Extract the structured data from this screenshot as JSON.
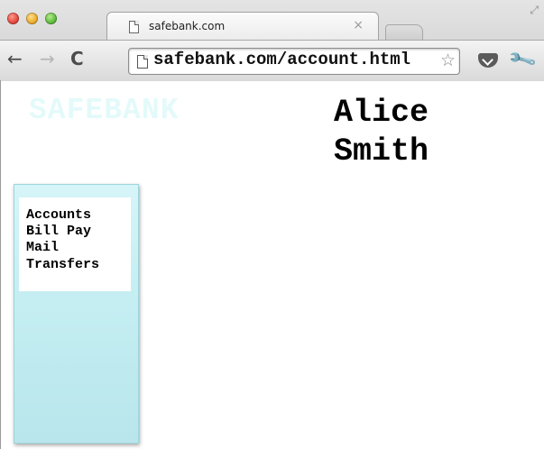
{
  "browser": {
    "tab_title": "safebank.com",
    "tab_close": "×",
    "url": "safebank.com/account.html",
    "nav": {
      "back": "←",
      "forward": "→",
      "reload": "C"
    },
    "star": "☆",
    "wrench": "🔧",
    "fullscreen": "⤢"
  },
  "page": {
    "logo": "SAFEBANK",
    "user_first": "Alice",
    "user_last": "Smith",
    "nav_items": [
      "Accounts",
      "Bill Pay",
      "Mail",
      "Transfers"
    ]
  },
  "colors": {
    "logo": "#e4fafa",
    "sidebar_top": "#d6f5f8",
    "sidebar_bottom": "#b8e6ec"
  }
}
